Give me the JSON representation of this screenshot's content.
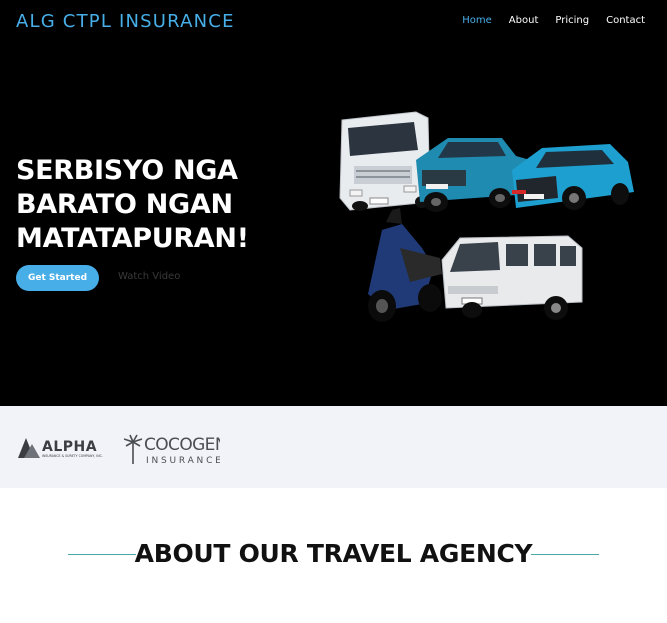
{
  "header": {
    "brand": "ALG CTPL INSURANCE",
    "nav": [
      {
        "label": "Home",
        "active": true
      },
      {
        "label": "About",
        "active": false
      },
      {
        "label": "Pricing",
        "active": false
      },
      {
        "label": "Contact",
        "active": false
      }
    ]
  },
  "hero": {
    "headline_lines": [
      "SERBISYO NGA",
      "BARATO NGAN",
      "MATATAPURAN!"
    ],
    "cta_label": "Get Started",
    "video_label": "Watch Video"
  },
  "partners": {
    "alpha_name": "ALPHA",
    "alpha_sub": "INSURANCE & SURETY COMPANY, INC.",
    "cocogen_name": "COCOGEN",
    "cocogen_sub": "INSURANCE"
  },
  "about": {
    "title": "ABOUT OUR TRAVEL AGENCY"
  },
  "colors": {
    "accent": "#47aee8",
    "hero_bg": "#000000",
    "partners_bg": "#f2f3f8",
    "rule": "#4aa9a6"
  }
}
